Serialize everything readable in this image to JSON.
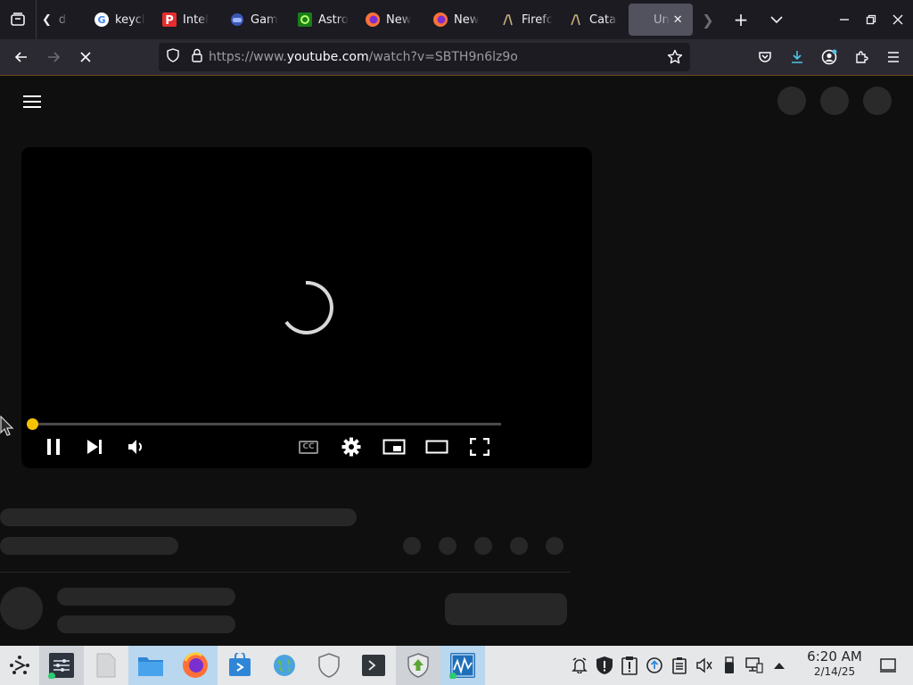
{
  "browser": {
    "tabs": [
      {
        "label": "d",
        "favicon": "back-chevron"
      },
      {
        "label": "keycl",
        "favicon": "google-icon"
      },
      {
        "label": "Intel",
        "favicon": "p-icon"
      },
      {
        "label": "Gam",
        "favicon": "game-icon"
      },
      {
        "label": "Astro",
        "favicon": "astro-icon"
      },
      {
        "label": "New",
        "favicon": "firefox-icon"
      },
      {
        "label": "New",
        "favicon": "firefox-icon"
      },
      {
        "label": "Firefc",
        "favicon": "pen-icon"
      },
      {
        "label": "Catal",
        "favicon": "pen-icon"
      },
      {
        "label": "Un",
        "favicon": "none",
        "active": true
      }
    ],
    "url": {
      "prefix": "https://www.",
      "host": "youtube.com",
      "path": "/watch?v=SBTH9n6lz9o"
    }
  },
  "player": {
    "progress": 0.0,
    "knob_color": "#f7c300",
    "controls": [
      "pause-icon",
      "next-icon",
      "volume-icon",
      "captions-icon",
      "settings-icon",
      "miniplayer-icon",
      "theater-icon",
      "fullscreen-icon"
    ],
    "captions_label": "CC"
  },
  "taskbar": {
    "clock": {
      "time": "6:20 AM",
      "date": "2/14/25"
    }
  }
}
